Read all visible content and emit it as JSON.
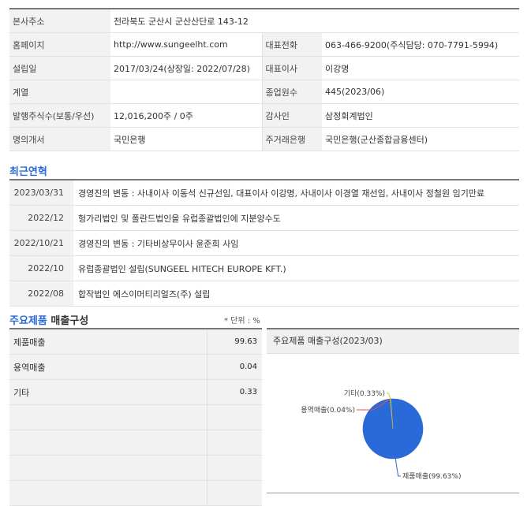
{
  "company_info": {
    "hq_label": "본사주소",
    "hq_value": "전라북도 군산시 군산산단로 143-12",
    "homepage_label": "홈페이지",
    "homepage_value": "http://www.sungeelht.com",
    "phone_label": "대표전화",
    "phone_value": "063-466-9200(주식담당: 070-7791-5994)",
    "founded_label": "설립일",
    "founded_value": "2017/03/24(상장일: 2022/07/28)",
    "ceo_label": "대표이사",
    "ceo_value": "이강명",
    "group_label": "계열",
    "group_value": "",
    "employees_label": "종업원수",
    "employees_value": "445(2023/06)",
    "shares_label": "발행주식수(보통/우선)",
    "shares_value": "12,016,200주 / 0주",
    "auditor_label": "감사인",
    "auditor_value": "삼정회계법인",
    "transfer_label": "명의개서",
    "transfer_value": "국민은행",
    "bank_label": "주거래은행",
    "bank_value": "국민은행(군산종합금융센터)"
  },
  "history": {
    "title": "최근연혁",
    "rows": [
      {
        "date": "2023/03/31",
        "event": "경영진의 변동 : 사내이사 이동석 신규선임, 대표이사 이강명, 사내이사 이경열 재선임, 사내이사 정철원 임기만료"
      },
      {
        "date": "2022/12",
        "event": "헝가리법인 및 폴란드법인을 유럽종괄법인에 지분양수도"
      },
      {
        "date": "2022/10/21",
        "event": "경영진의 변동 : 기타비상무이사 윤준희 사임"
      },
      {
        "date": "2022/10",
        "event": "유럽종괄법인 설립(SUNGEEL HITECH EUROPE KFT.)"
      },
      {
        "date": "2022/08",
        "event": "합작법인 에스이머티리얼즈(주) 설립"
      }
    ]
  },
  "products": {
    "title_blue": "주요제품",
    "title_rest": " 매출구성",
    "unit": "* 단위 : %",
    "rows": [
      {
        "name": "제품매출",
        "value": "99.63"
      },
      {
        "name": "용역매출",
        "value": "0.04"
      },
      {
        "name": "기타",
        "value": "0.33"
      },
      {
        "name": "",
        "value": ""
      },
      {
        "name": "",
        "value": ""
      },
      {
        "name": "",
        "value": ""
      },
      {
        "name": "",
        "value": ""
      }
    ]
  },
  "chart_header": "주요제품 매출구성(2023/03)",
  "chart_data": {
    "type": "pie",
    "title": "주요제품 매출구성(2023/03)",
    "slices": [
      {
        "label": "제품매출(99.63%)",
        "name": "제품매출",
        "value": 99.63,
        "color": "#2a6ad8"
      },
      {
        "label": "용역매출(0.04%)",
        "name": "용역매출",
        "value": 0.04,
        "color": "#e0504a"
      },
      {
        "label": "기타(0.33%)",
        "name": "기타",
        "value": 0.33,
        "color": "#c7c43a"
      }
    ]
  }
}
